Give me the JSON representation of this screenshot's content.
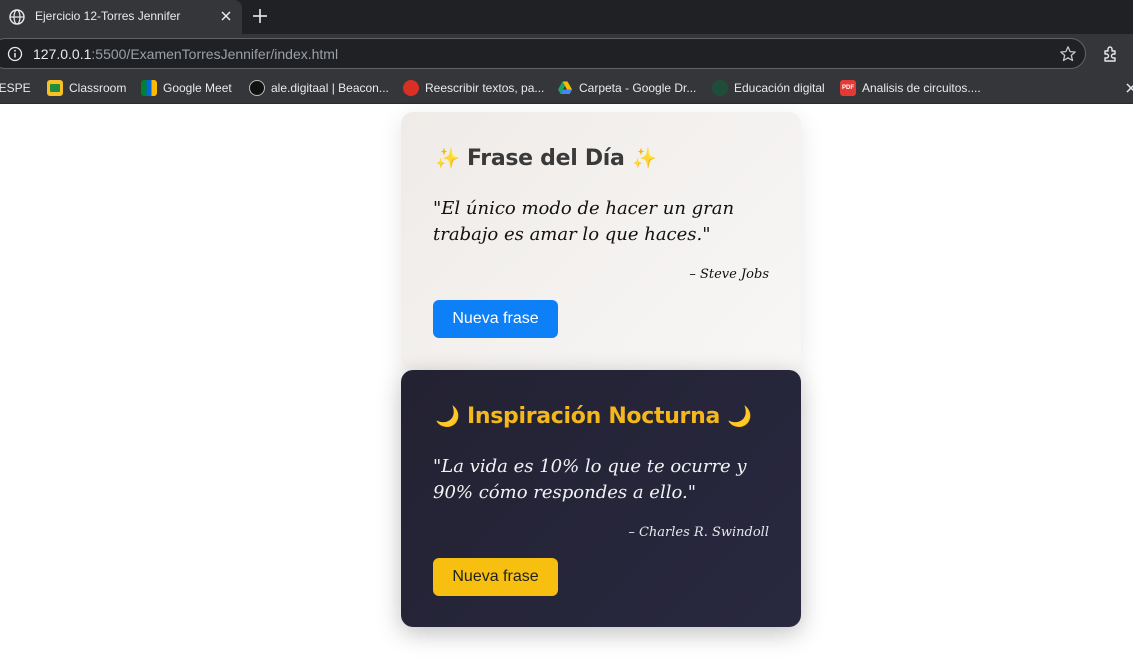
{
  "browser": {
    "tab_title": "Ejercicio 12-Torres Jennifer",
    "url_host": "127.0.0.1",
    "url_rest": ":5500/ExamenTorresJennifer/index.html"
  },
  "bookmarks": [
    {
      "label": "MiESPE",
      "icon": "miespe-icon"
    },
    {
      "label": "Classroom",
      "icon": "classroom-icon"
    },
    {
      "label": "Google Meet",
      "icon": "google-meet-icon"
    },
    {
      "label": "ale.digitaal | Beacon...",
      "icon": "beacon-icon"
    },
    {
      "label": "Reescribir textos, pa...",
      "icon": "rewrite-icon"
    },
    {
      "label": "Carpeta - Google Dr...",
      "icon": "google-drive-icon"
    },
    {
      "label": "Educación digital",
      "icon": "education-icon"
    },
    {
      "label": "Analisis de circuitos....",
      "icon": "pdf-icon"
    }
  ],
  "cards": {
    "day": {
      "emoji": "✨",
      "title": "Frase del Día",
      "quote": "\"El único modo de hacer un gran trabajo es amar lo que haces.\"",
      "author": "– Steve Jobs",
      "button": "Nueva frase",
      "accent": "#0d7ff7"
    },
    "night": {
      "emoji": "🌙",
      "title": "Inspiración Nocturna",
      "quote": "\"La vida es 10% lo que te ocurre y 90% cómo respondes a ello.\"",
      "author": "– Charles R. Swindoll",
      "button": "Nueva frase",
      "accent": "#f7bf0f"
    }
  }
}
